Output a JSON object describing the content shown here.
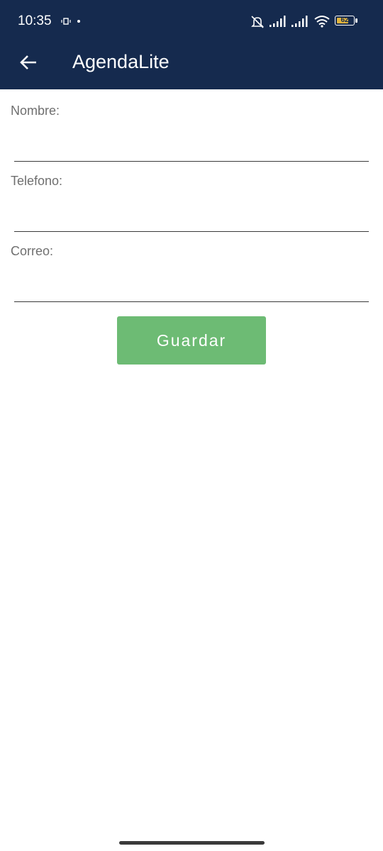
{
  "status_bar": {
    "time": "10:35",
    "battery": "62"
  },
  "toolbar": {
    "title": "AgendaLite",
    "back_icon": "arrow-left-icon"
  },
  "form": {
    "nombre_label": "Nombre:",
    "nombre_value": "",
    "telefono_label": "Telefono:",
    "telefono_value": "",
    "correo_label": "Correo:",
    "correo_value": "",
    "save_label": "Guardar"
  },
  "colors": {
    "appbar": "#152a4e",
    "button": "#6dbb74"
  }
}
